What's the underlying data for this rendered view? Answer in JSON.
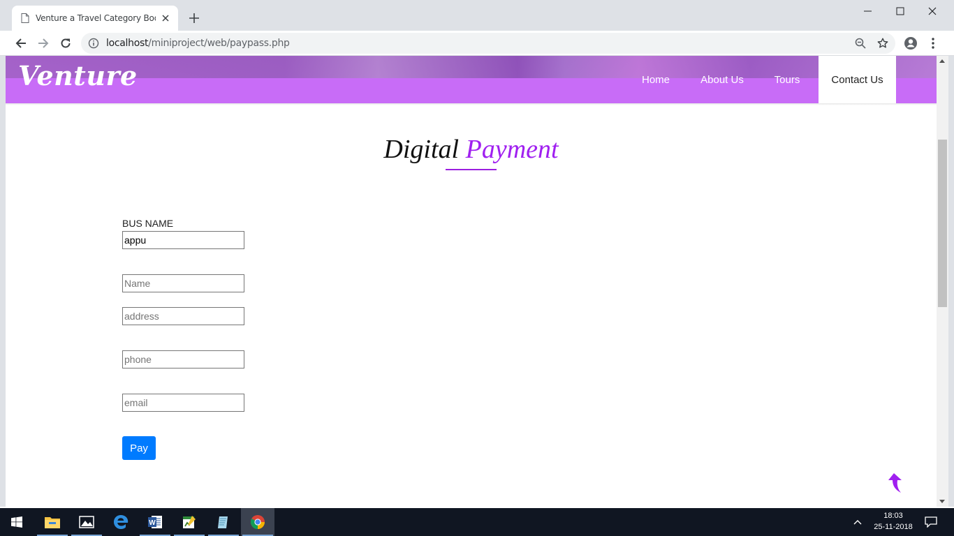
{
  "browser": {
    "tab_title": "Venture a Travel Category Bootstrap Responsive Website Template",
    "url_host": "localhost",
    "url_path": "/miniproject/web/paypass.php"
  },
  "site": {
    "logo": "Venture",
    "nav": [
      "Home",
      "About Us",
      "Tours",
      "Contact Us"
    ],
    "active_nav": "Contact Us",
    "brand_color": "#c86cf7",
    "accent_color": "#a020f0"
  },
  "page": {
    "heading_main": "Digital",
    "heading_accent": "Payment"
  },
  "form": {
    "bus_label": "BUS NAME",
    "bus_value": "appu",
    "name_placeholder": "Name",
    "address_placeholder": "address",
    "phone_placeholder": "phone",
    "email_placeholder": "email",
    "pay_label": "Pay",
    "pay_color": "#007bff"
  },
  "taskbar": {
    "time": "18:03",
    "date": "25-11-2018",
    "apps": [
      "start-icon",
      "file-explorer-icon",
      "photos-icon",
      "edge-icon",
      "word-icon",
      "app-icon",
      "notepad-icon",
      "chrome-icon"
    ]
  }
}
